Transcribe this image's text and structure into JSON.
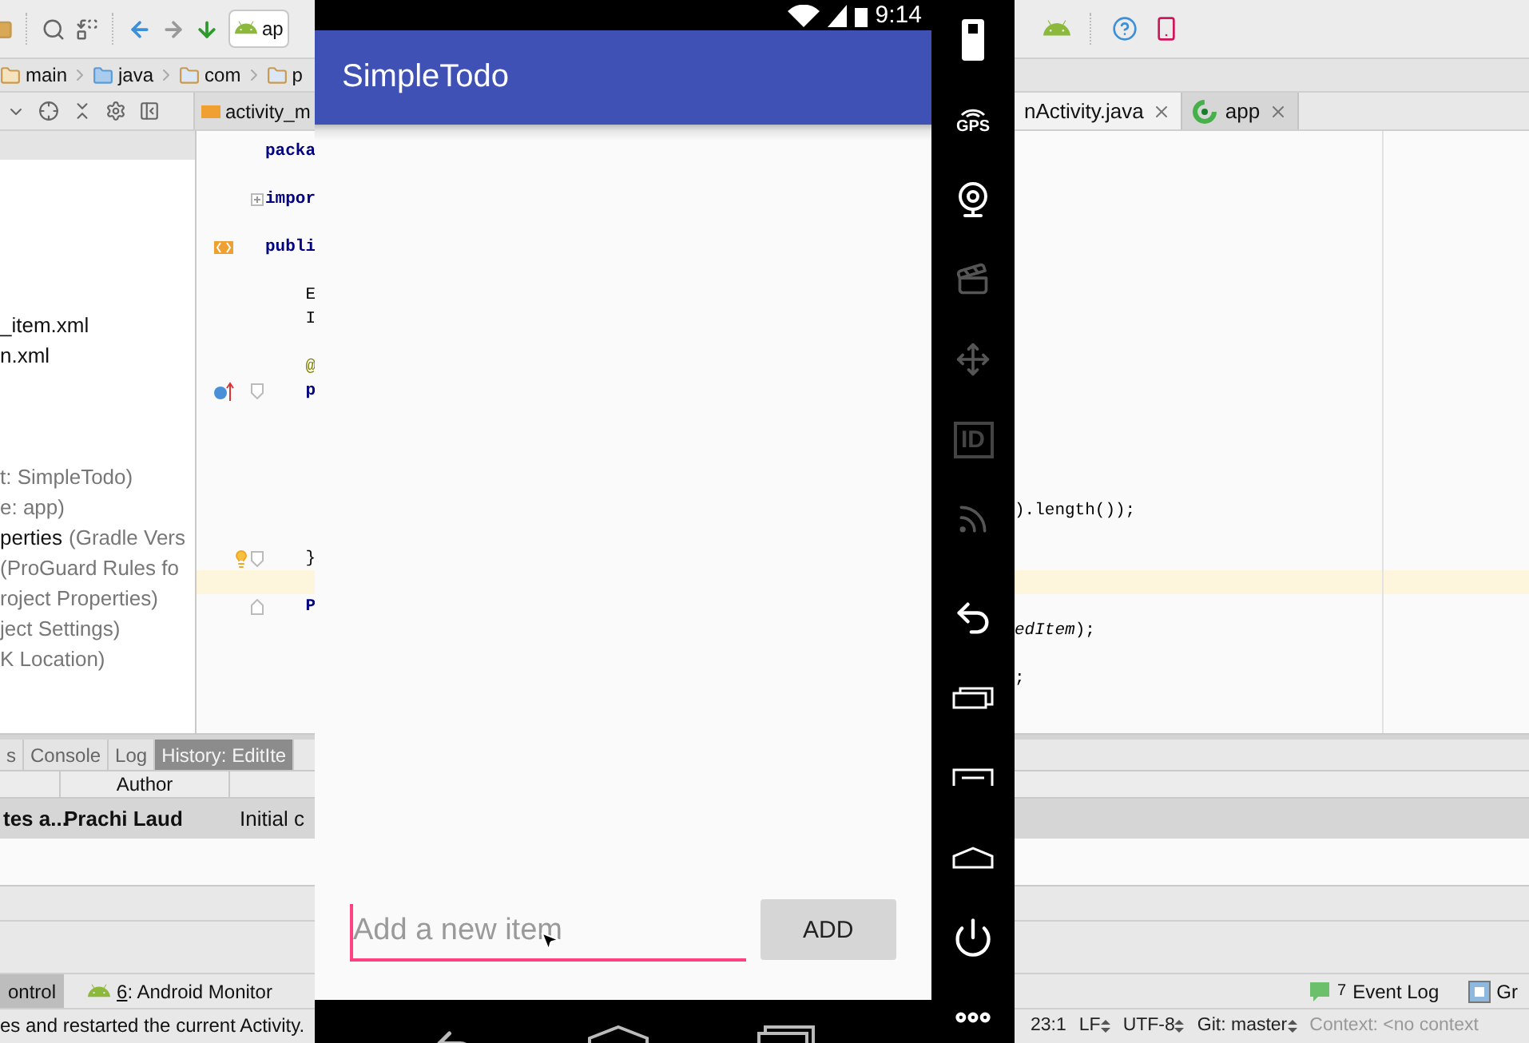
{
  "ide": {
    "toolbar": {
      "run_config": "ap"
    },
    "breadcrumbs": [
      {
        "label": "main",
        "kind": "folder"
      },
      {
        "label": "java",
        "kind": "source"
      },
      {
        "label": "com",
        "kind": "package"
      },
      {
        "label": "p",
        "kind": "package"
      }
    ],
    "editor_tab": "activity_m",
    "project_files": [
      {
        "name": "_item.xml"
      },
      {
        "name": "n.xml"
      }
    ],
    "gradle_scripts": [
      {
        "detail": "t: SimpleTodo)"
      },
      {
        "detail": "e: app)"
      },
      {
        "name": "perties",
        "detail": "(Gradle Vers"
      },
      {
        "detail": "(ProGuard Rules fo"
      },
      {
        "detail": "roject Properties)"
      },
      {
        "detail": "ject Settings)"
      },
      {
        "detail": "K Location)"
      }
    ],
    "editor_lines": [
      {
        "left": "packa",
        "kind": "keyword",
        "current": false
      },
      {
        "current": false
      },
      {
        "left": "impor",
        "kind": "keyword",
        "current": false
      },
      {
        "current": false
      },
      {
        "left": "publi",
        "kind": "keyword",
        "current": false
      },
      {
        "current": false
      },
      {
        "left": "    E",
        "kind": "plain",
        "current": false
      },
      {
        "left": "    I",
        "kind": "plain",
        "current": false
      },
      {
        "current": false
      },
      {
        "left": "    @",
        "kind": "annotation",
        "current": false
      },
      {
        "left": "    p",
        "kind": "keyword",
        "current": false
      },
      {
        "current": false
      },
      {
        "current": false
      },
      {
        "current": false
      },
      {
        "current": false
      },
      {
        "right": ").length());",
        "current": false
      },
      {
        "current": false
      },
      {
        "left": "    }",
        "kind": "plain",
        "current": false
      },
      {
        "current": true
      },
      {
        "left": "    P",
        "kind": "keyword",
        "current": false
      },
      {
        "right": "*edItem*);",
        "current": false
      },
      {
        "current": false
      },
      {
        "right": ";",
        "current": false
      }
    ],
    "file_tabs": [
      {
        "label": "nActivity.java",
        "kind": "java",
        "selected": true
      },
      {
        "label": "app",
        "kind": "app",
        "selected": false
      }
    ],
    "tool_tabs": [
      {
        "label": "s",
        "selected": false
      },
      {
        "label": "Console",
        "selected": false
      },
      {
        "label": "Log",
        "selected": false
      },
      {
        "label": "History: EditIte",
        "selected": true
      }
    ],
    "history": {
      "columns": [
        "",
        "Author"
      ],
      "rows": [
        {
          "cells": [
            "tes a...",
            "Prachi Laud",
            "Initial c"
          ],
          "selected": true
        }
      ]
    },
    "tool_windows": [
      {
        "label": "ontrol",
        "selected": true
      },
      {
        "key": "6",
        "label": ": Android Monitor",
        "selected": false
      }
    ],
    "right_tools": [
      {
        "badge": "7",
        "label": "Event Log",
        "kind": "log"
      },
      {
        "label": "Gr",
        "kind": "panel"
      }
    ],
    "status_message": "es and restarted the current Activity.",
    "status_items": [
      {
        "label": "23:1",
        "dropdown": false,
        "muted": false
      },
      {
        "label": "LF",
        "dropdown": true,
        "muted": false
      },
      {
        "label": "UTF-8",
        "dropdown": true,
        "muted": false
      },
      {
        "label": "Git: master",
        "dropdown": true,
        "muted": false
      },
      {
        "label": "Context: <no context",
        "dropdown": false,
        "muted": true
      }
    ]
  },
  "emulator": {
    "time": "9:14",
    "app_title": "SimpleTodo",
    "input": {
      "placeholder": "Add a new item",
      "focused": true
    },
    "add_button": "ADD",
    "side_labels": {
      "gps": "GPS",
      "id": "ID"
    }
  }
}
